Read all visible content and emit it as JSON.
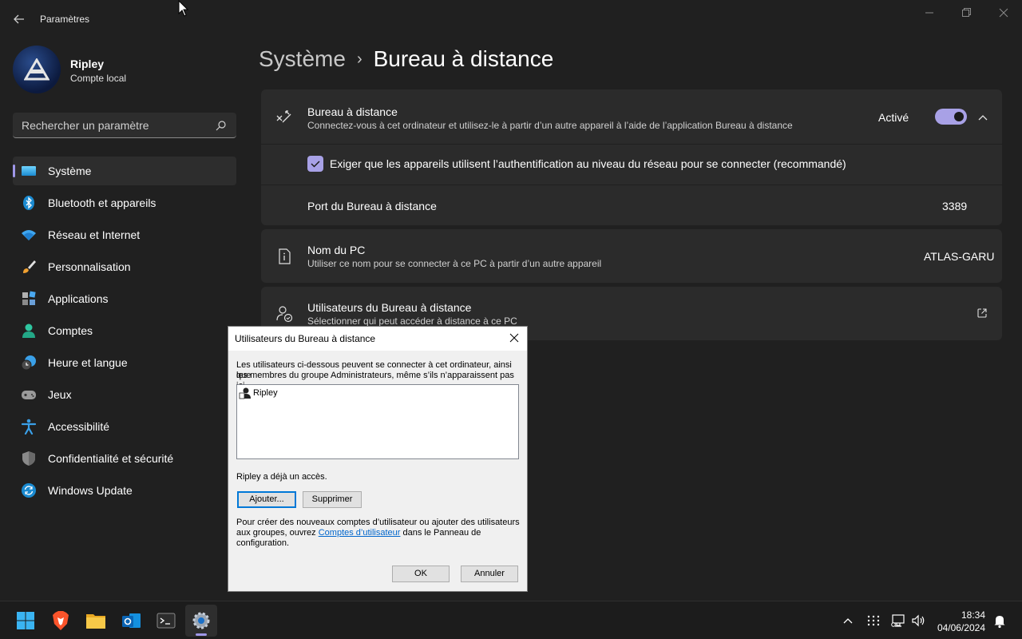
{
  "window": {
    "title": "Paramètres"
  },
  "user": {
    "name": "Ripley",
    "account_type": "Compte local"
  },
  "search": {
    "placeholder": "Rechercher un paramètre"
  },
  "sidebar": {
    "items": [
      {
        "label": "Système",
        "icon": "system-display-icon",
        "active": true
      },
      {
        "label": "Bluetooth et appareils",
        "icon": "bluetooth-icon"
      },
      {
        "label": "Réseau et Internet",
        "icon": "wifi-icon"
      },
      {
        "label": "Personnalisation",
        "icon": "paintbrush-icon"
      },
      {
        "label": "Applications",
        "icon": "apps-icon"
      },
      {
        "label": "Comptes",
        "icon": "person-icon"
      },
      {
        "label": "Heure et langue",
        "icon": "clock-globe-icon"
      },
      {
        "label": "Jeux",
        "icon": "gamepad-icon"
      },
      {
        "label": "Accessibilité",
        "icon": "accessibility-icon"
      },
      {
        "label": "Confidentialité et sécurité",
        "icon": "shield-icon"
      },
      {
        "label": "Windows Update",
        "icon": "update-icon"
      }
    ]
  },
  "breadcrumb": {
    "parent": "Système",
    "separator": "›",
    "current": "Bureau à distance"
  },
  "remote_desktop": {
    "title": "Bureau à distance",
    "subtitle": "Connectez-vous à cet ordinateur et utilisez-le à partir d’un autre appareil à l’aide de l’application Bureau à distance",
    "state_label": "Activé",
    "enabled": true,
    "nla_label": "Exiger que les appareils utilisent l’authentification au niveau du réseau pour se connecter (recommandé)",
    "nla_checked": true,
    "port_label": "Port du Bureau à distance",
    "port_value": "3389"
  },
  "pc_name": {
    "title": "Nom du PC",
    "subtitle": "Utiliser ce nom pour se connecter à ce PC à partir d’un autre appareil",
    "value": "ATLAS-GARU"
  },
  "rd_users": {
    "title": "Utilisateurs du Bureau à distance",
    "subtitle": "Sélectionner qui peut accéder à distance à ce PC"
  },
  "dialog": {
    "title": "Utilisateurs du Bureau à distance",
    "intro_line1": "Les utilisateurs ci-dessous peuvent se connecter à cet ordinateur, ainsi que",
    "intro_line2": "les membres du groupe Administrateurs, même s’ils n’apparaissent pas ici.",
    "users": [
      "Ripley"
    ],
    "access_note": "Ripley a déjà un accès.",
    "add_label": "Ajouter...",
    "remove_label": "Supprimer",
    "footer_line1": "Pour créer des nouveaux comptes d’utilisateur ou ajouter des utilisateurs",
    "footer_pre": "aux groupes, ouvrez ",
    "footer_link": "Comptes d’utilisateur",
    "footer_post": " dans le Panneau de",
    "footer_line3": "configuration.",
    "ok_label": "OK",
    "cancel_label": "Annuler"
  },
  "taskbar": {
    "apps": [
      "start-icon",
      "brave-icon",
      "file-explorer-icon",
      "outlook-icon",
      "terminal-icon",
      "settings-icon"
    ],
    "time": "18:34",
    "date": "04/06/2024"
  },
  "colors": {
    "accent": "#a8a1e6",
    "background": "#202020",
    "card": "#2b2b2b"
  }
}
